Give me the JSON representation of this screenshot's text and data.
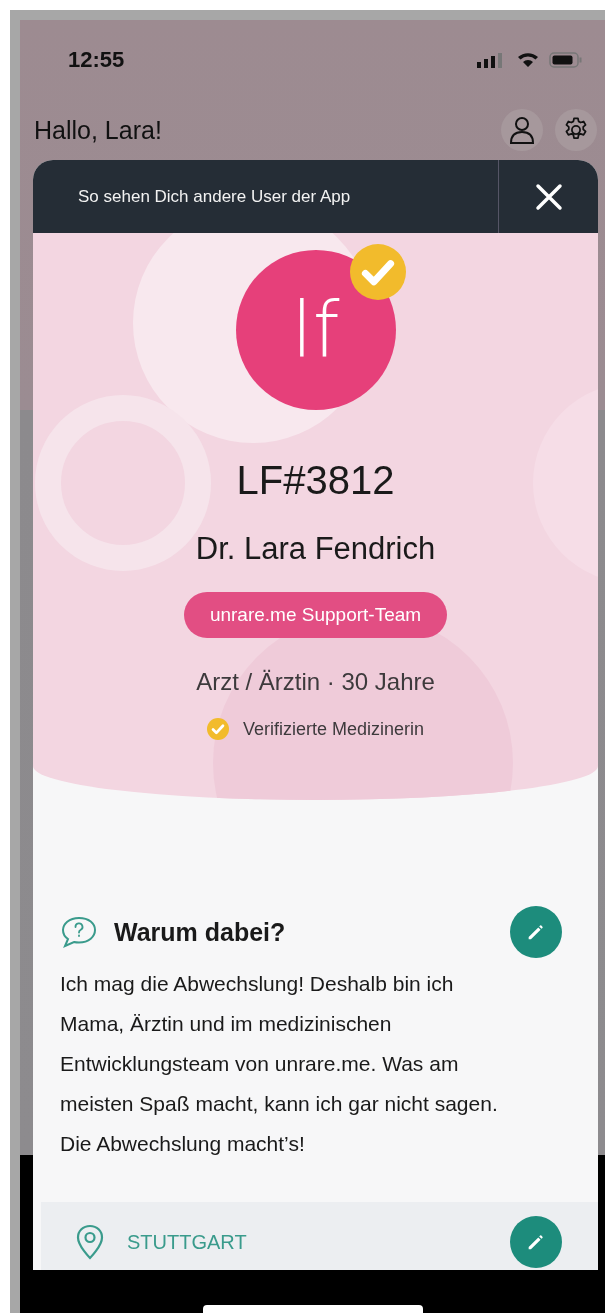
{
  "status_bar": {
    "time": "12:55"
  },
  "greeting": "Hallo, Lara!",
  "modal": {
    "title": "So sehen Dich andere User der App"
  },
  "profile": {
    "avatar_initials": "lf",
    "verified": true,
    "handle": "LF#3812",
    "name": "Dr. Lara Fendrich",
    "badge": "unrare.me Support-Team",
    "details": "Arzt / Ärztin · 30 Jahre",
    "verification": "Verifizierte Medizinerin"
  },
  "sections": [
    {
      "kind": "text",
      "title": "Warum dabei?",
      "body": "Ich mag die Abwechslung! Deshalb bin ich Mama, Ärztin und im medizinischen Entwicklungsteam von unrare.me. Was am meisten Spaß macht, kann ich gar nicht sagen. Die Abwechslung macht’s!"
    },
    {
      "kind": "location",
      "value": "STUTTGART"
    }
  ]
}
